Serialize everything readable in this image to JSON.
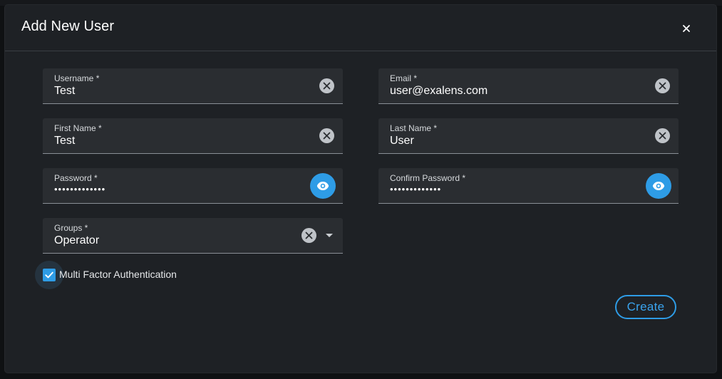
{
  "dialog": {
    "title": "Add New User"
  },
  "fields": {
    "username": {
      "label": "Username *",
      "value": "Test"
    },
    "email": {
      "label": "Email *",
      "value": "user@exalens.com"
    },
    "first_name": {
      "label": "First Name *",
      "value": "Test"
    },
    "last_name": {
      "label": "Last Name *",
      "value": "User"
    },
    "password": {
      "label": "Password *",
      "value": "•••••••••••••"
    },
    "confirm_password": {
      "label": "Confirm Password *",
      "value": "•••••••••••••"
    },
    "groups": {
      "label": "Groups *",
      "value": "Operator"
    }
  },
  "mfa": {
    "label": "Multi Factor Authentication",
    "checked": true
  },
  "actions": {
    "create_label": "Create"
  },
  "colors": {
    "accent": "#2e9ce6",
    "background": "#1e2125",
    "field": "#2a2d31"
  },
  "icons": [
    "close-icon",
    "clear-icon",
    "eye-icon",
    "chevron-down-icon",
    "checkmark-icon"
  ]
}
